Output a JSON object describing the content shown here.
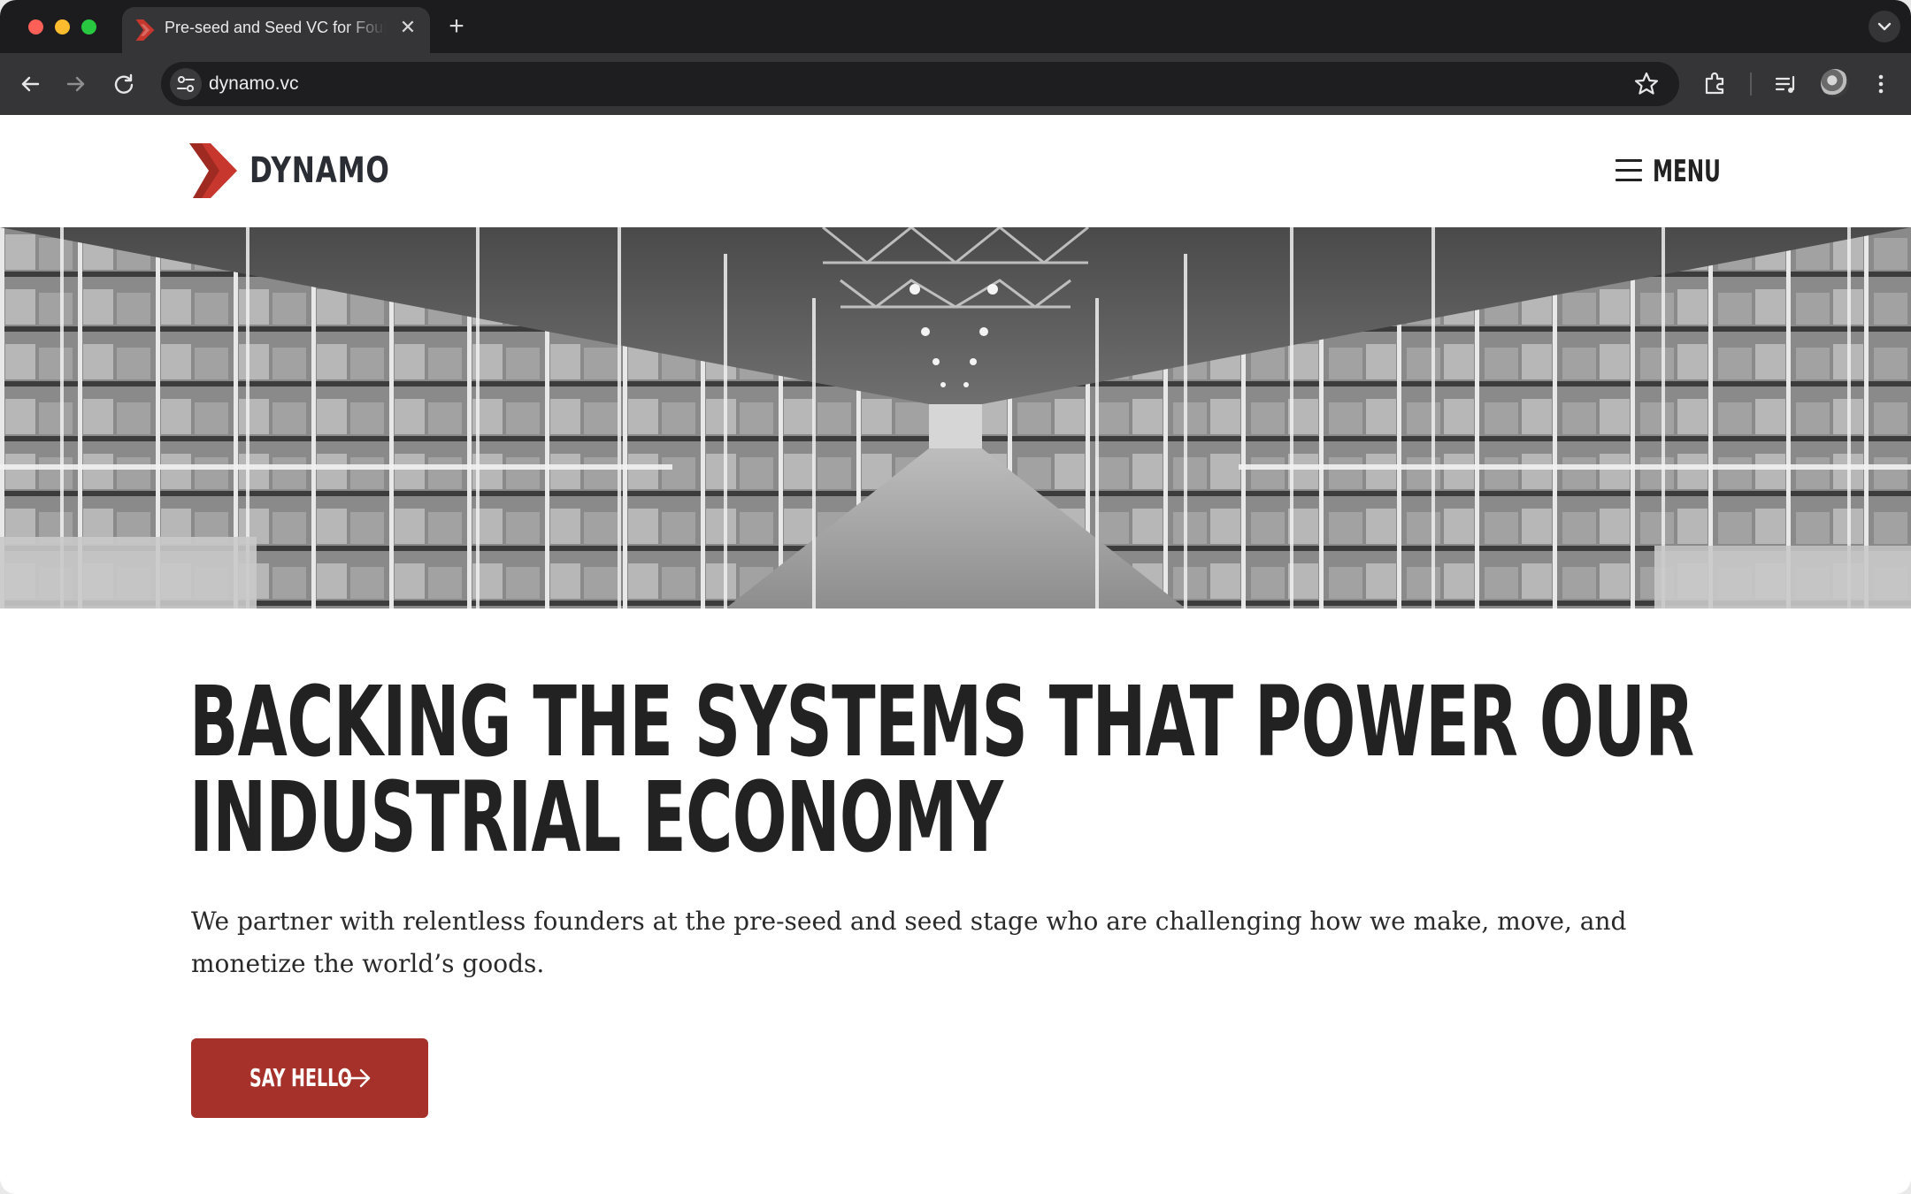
{
  "browser": {
    "tab": {
      "title": "Pre-seed and Seed VC for Founders",
      "favicon": "dynamo-logo-icon",
      "close_glyph": "✕"
    },
    "new_tab_glyph": "+",
    "url": "dynamo.vc",
    "icons": [
      "back-arrow-icon",
      "forward-arrow-icon",
      "reload-icon",
      "site-info-icon",
      "star-icon",
      "extensions-icon",
      "media-control-icon",
      "profile-avatar",
      "more-menu-icon",
      "tab-search-icon"
    ]
  },
  "site": {
    "logo_text": "DYNAMO",
    "menu_label": "MENU",
    "hero": {
      "headline": "BACKING THE SYSTEMS THAT POWER OUR INDUSTRIAL ECONOMY",
      "subhead": "We partner with relentless founders at the pre-seed and seed stage who are challenging how we make, move, and monetize the world’s goods.",
      "cta_label": "SAY HELLO",
      "image": "warehouse-aisle-photo"
    }
  },
  "colors": {
    "brand_red": "#a6312a",
    "logo_red": "#c8372d",
    "text_dark": "#222222",
    "chrome_dark": "#1c1c1e",
    "chrome_toolbar": "#353537"
  }
}
